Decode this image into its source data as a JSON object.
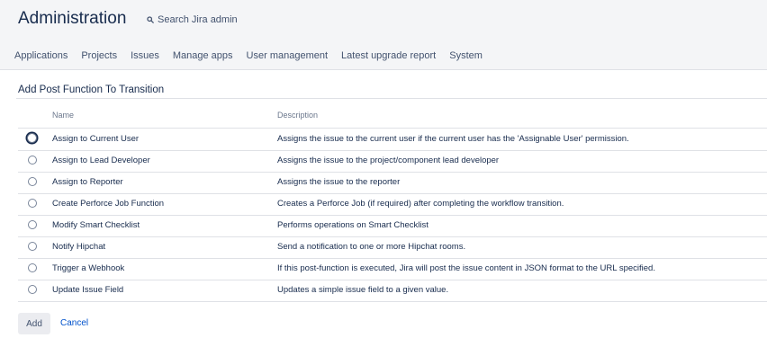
{
  "header": {
    "title": "Administration",
    "search_label": "Search Jira admin"
  },
  "nav": {
    "items": [
      {
        "label": "Applications"
      },
      {
        "label": "Projects"
      },
      {
        "label": "Issues"
      },
      {
        "label": "Manage apps"
      },
      {
        "label": "User management"
      },
      {
        "label": "Latest upgrade report"
      },
      {
        "label": "System"
      }
    ]
  },
  "page": {
    "title": "Add Post Function To Transition"
  },
  "table": {
    "columns": {
      "name": "Name",
      "description": "Description"
    },
    "rows": [
      {
        "name": "Assign to Current User",
        "description": "Assigns the issue to the current user if the current user has the 'Assignable User' permission."
      },
      {
        "name": "Assign to Lead Developer",
        "description": "Assigns the issue to the project/component lead developer"
      },
      {
        "name": "Assign to Reporter",
        "description": "Assigns the issue to the reporter"
      },
      {
        "name": "Create Perforce Job Function",
        "description": "Creates a Perforce Job (if required) after completing the workflow transition."
      },
      {
        "name": "Modify Smart Checklist",
        "description": "Performs operations on Smart Checklist"
      },
      {
        "name": "Notify Hipchat",
        "description": "Send a notification to one or more Hipchat rooms."
      },
      {
        "name": "Trigger a Webhook",
        "description": "If this post-function is executed, Jira will post the issue content in JSON format to the URL specified."
      },
      {
        "name": "Update Issue Field",
        "description": "Updates a simple issue field to a given value."
      }
    ]
  },
  "actions": {
    "add_label": "Add",
    "cancel_label": "Cancel"
  },
  "colors": {
    "header_bg": "#f4f5f7",
    "text": "#172b4d",
    "link": "#0052cc",
    "border": "#dfe1e6"
  }
}
